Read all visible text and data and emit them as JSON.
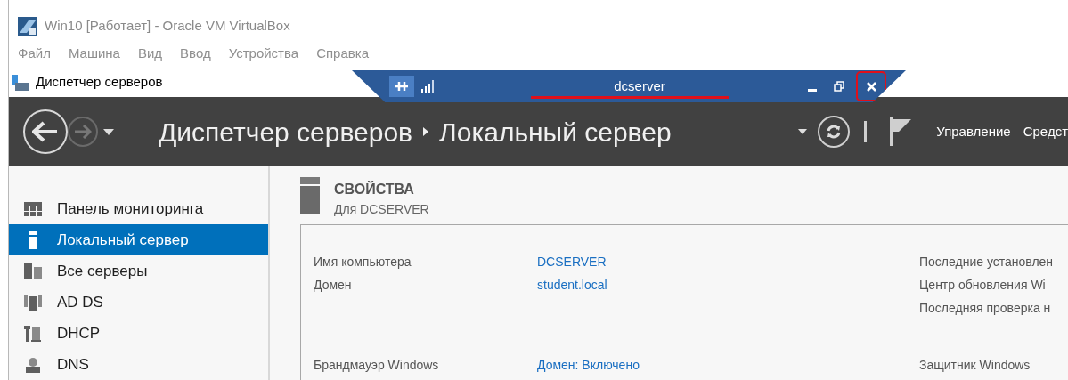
{
  "window": {
    "title": "Win10 [Работает] - Oracle VM VirtualBox"
  },
  "menu": [
    "Файл",
    "Машина",
    "Вид",
    "Ввод",
    "Устройства",
    "Справка"
  ],
  "app_title": "Диспетчер серверов",
  "mini_toolbar": {
    "title": "dcserver"
  },
  "header": {
    "breadcrumb": [
      "Диспетчер серверов",
      "Локальный сервер"
    ],
    "actions": [
      "Управление",
      "Средст"
    ]
  },
  "sidebar": {
    "items": [
      {
        "label": "Панель мониторинга",
        "kind": "dashboard",
        "selected": false
      },
      {
        "label": "Локальный сервер",
        "kind": "server",
        "selected": true
      },
      {
        "label": "Все серверы",
        "kind": "servers",
        "selected": false
      },
      {
        "label": "AD DS",
        "kind": "adds",
        "selected": false
      },
      {
        "label": "DHCP",
        "kind": "dhcp",
        "selected": false
      },
      {
        "label": "DNS",
        "kind": "dns",
        "selected": false
      }
    ]
  },
  "properties": {
    "title": "СВОЙСТВА",
    "subtitle": "Для DCSERVER",
    "left": [
      [
        {
          "label": "Имя компьютера",
          "value": "DCSERVER"
        },
        {
          "label": "Домен",
          "value": "student.local"
        }
      ],
      [
        {
          "label": "Брандмауэр Windows",
          "value": "Домен: Включено"
        }
      ]
    ],
    "right": [
      [
        "Последние установлен",
        "Центр обновления Wi",
        "Последняя проверка н"
      ],
      [
        "Защитник Windows"
      ]
    ]
  }
}
